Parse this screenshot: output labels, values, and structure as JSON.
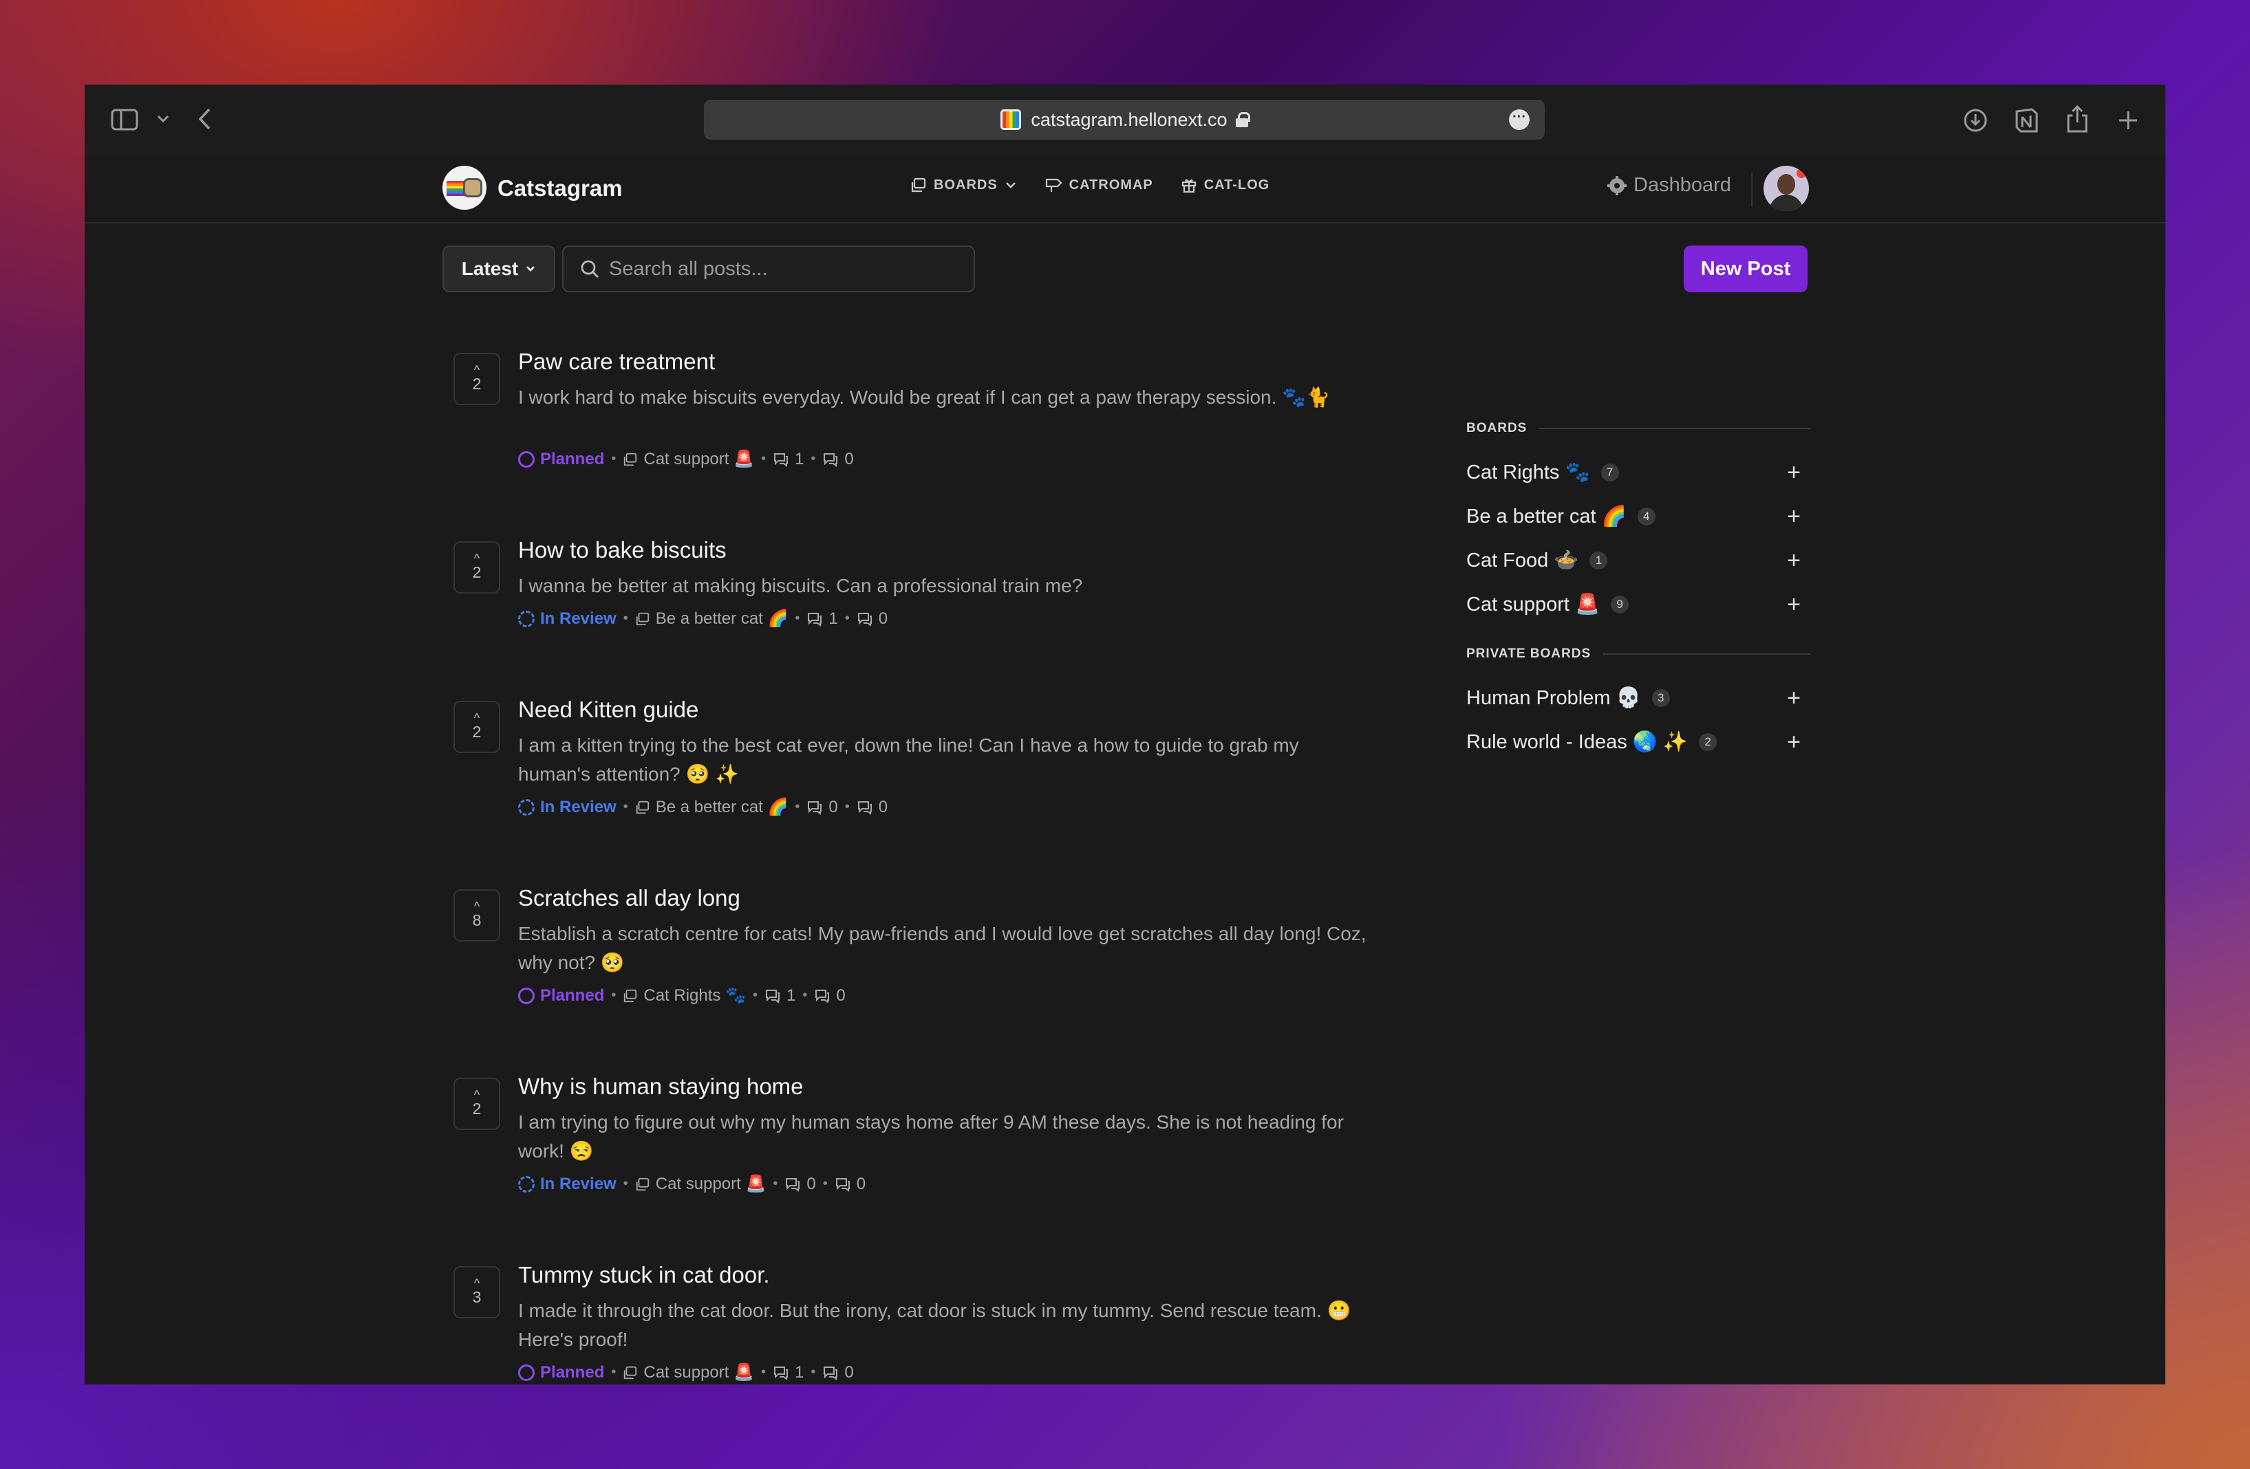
{
  "browser": {
    "url": "catstagram.hellonext.co"
  },
  "app": {
    "brand": "Catstagram",
    "nav": [
      {
        "label": "BOARDS",
        "icon": "boards-icon",
        "has_dropdown": true
      },
      {
        "label": "CATROMAP",
        "icon": "signpost-icon"
      },
      {
        "label": "CAT-LOG",
        "icon": "gift-icon"
      }
    ],
    "dashboard_label": "Dashboard"
  },
  "controls": {
    "sort_label": "Latest",
    "search_placeholder": "Search all posts...",
    "new_post_label": "New Post"
  },
  "posts": [
    {
      "votes": "2",
      "title": "Paw care treatment",
      "description": "I work hard to make biscuits everyday. Would be great if I can get a paw therapy session. 🐾🐈",
      "status": "Planned",
      "board": "Cat support 🚨",
      "comments": "1",
      "replies": "0"
    },
    {
      "votes": "2",
      "title": "How to bake biscuits",
      "description": "I wanna be better at making biscuits. Can a professional train me?",
      "status": "In Review",
      "board": "Be a better cat 🌈",
      "comments": "1",
      "replies": "0"
    },
    {
      "votes": "2",
      "title": "Need Kitten guide",
      "description": "I am a kitten trying to the best cat ever, down the line! Can I have a how to guide to grab my human's attention? 🥺 ✨",
      "status": "In Review",
      "board": "Be a better cat 🌈",
      "comments": "0",
      "replies": "0"
    },
    {
      "votes": "8",
      "title": "Scratches all day long",
      "description": "Establish a scratch centre for cats! My paw-friends and I would love get scratches all day long! Coz, why not? 🥺",
      "status": "Planned",
      "board": "Cat Rights 🐾",
      "comments": "1",
      "replies": "0"
    },
    {
      "votes": "2",
      "title": "Why is human staying home",
      "description": "I am trying to figure out why my human stays home after 9 AM these days. She is not heading for work! 😒",
      "status": "In Review",
      "board": "Cat support 🚨",
      "comments": "0",
      "replies": "0"
    },
    {
      "votes": "3",
      "title": "Tummy stuck in cat door.",
      "description": "I made it through the cat door. But the irony, cat door is stuck in my tummy. Send rescue team. 😬 Here's proof!",
      "status": "Planned",
      "board": "Cat support 🚨",
      "comments": "1",
      "replies": "0"
    }
  ],
  "sidebar": {
    "boards_heading": "BOARDS",
    "boards": [
      {
        "label": "Cat Rights 🐾",
        "count": "7"
      },
      {
        "label": "Be a better cat 🌈",
        "count": "4"
      },
      {
        "label": "Cat Food 🍲",
        "count": "1"
      },
      {
        "label": "Cat support 🚨",
        "count": "9"
      }
    ],
    "private_heading": "PRIVATE BOARDS",
    "private_boards": [
      {
        "label": "Human Problem 💀",
        "count": "3"
      },
      {
        "label": "Rule world - Ideas 🌏 ✨",
        "count": "2"
      }
    ]
  },
  "colors": {
    "accent": "#7c24d8",
    "planned": "#8a4bea",
    "in_review": "#4a78e8",
    "background": "#1a1a1a"
  }
}
